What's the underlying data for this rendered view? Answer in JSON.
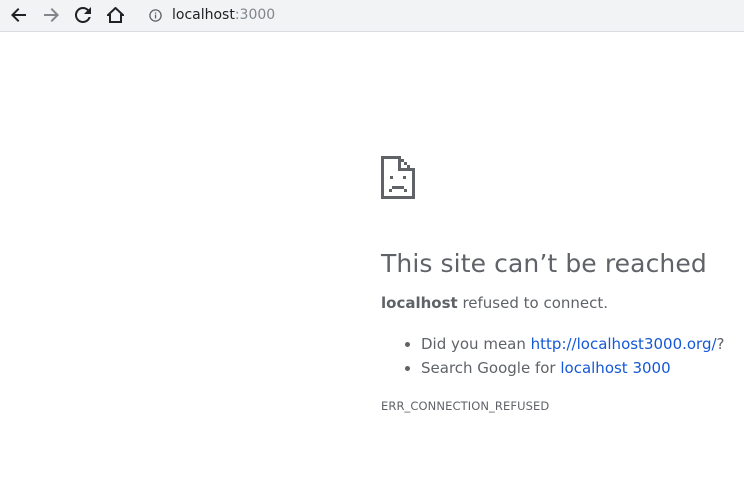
{
  "browser": {
    "url_host": "localhost",
    "url_port": ":3000"
  },
  "error_page": {
    "title": "This site can’t be reached",
    "host": "localhost",
    "message_rest": " refused to connect.",
    "suggestions": [
      {
        "prefix": "Did you mean ",
        "link": "http://localhost3000.org/",
        "suffix": "?"
      },
      {
        "prefix": "Search Google for ",
        "link": "localhost 3000",
        "suffix": ""
      }
    ],
    "error_code": "ERR_CONNECTION_REFUSED"
  },
  "icons": {
    "back": "back-arrow-icon",
    "forward": "forward-arrow-icon",
    "reload": "reload-icon",
    "home": "home-icon",
    "info": "info-icon",
    "page": "sad-page-icon"
  }
}
